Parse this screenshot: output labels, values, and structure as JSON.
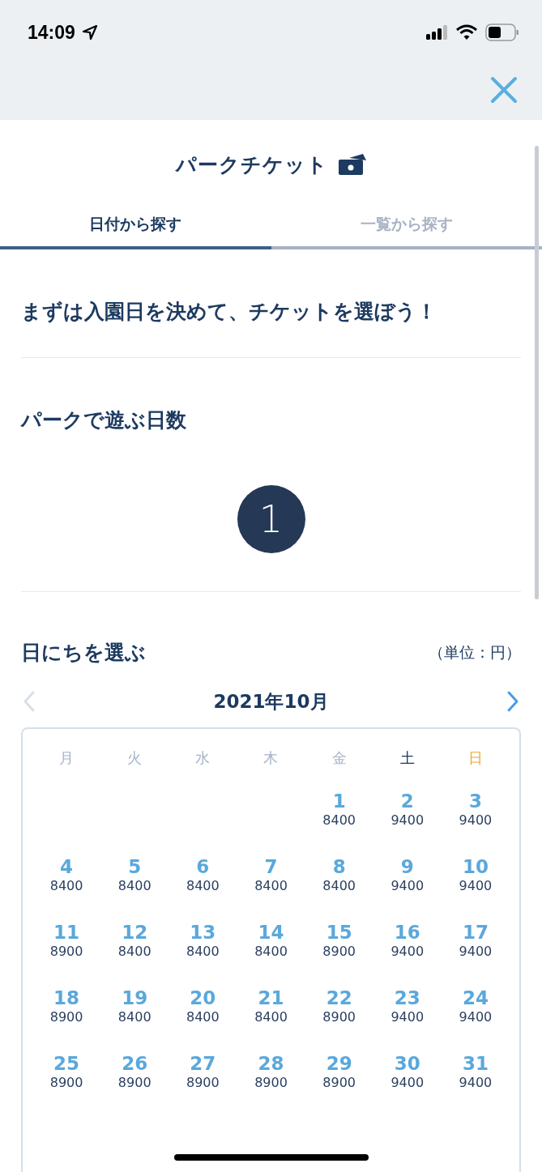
{
  "status_bar": {
    "time": "14:09"
  },
  "header": {
    "title": "パークチケット"
  },
  "tabs": [
    {
      "label": "日付から探す",
      "selected": true
    },
    {
      "label": "一覧から探す",
      "selected": false
    }
  ],
  "intro": "まずは入園日を決めて、チケットを選ぼう！",
  "days_section": {
    "heading": "パークで遊ぶ日数",
    "count": "1"
  },
  "calendar_section": {
    "heading": "日にちを選ぶ",
    "unit_note": "（単位：円）",
    "month": "2021年10月",
    "prev_month": {
      "disabled": true
    },
    "next_month": {
      "disabled": false
    },
    "weekdays": [
      {
        "label": "月",
        "kind": "weekday"
      },
      {
        "label": "火",
        "kind": "weekday"
      },
      {
        "label": "水",
        "kind": "weekday"
      },
      {
        "label": "木",
        "kind": "weekday"
      },
      {
        "label": "金",
        "kind": "weekday"
      },
      {
        "label": "土",
        "kind": "saturday"
      },
      {
        "label": "日",
        "kind": "sunday"
      }
    ],
    "weeks": [
      [
        {
          "kind": "empty"
        },
        {
          "kind": "empty"
        },
        {
          "kind": "empty"
        },
        {
          "kind": "empty"
        },
        {
          "kind": "day",
          "day": "1",
          "price": "8400"
        },
        {
          "kind": "day",
          "day": "2",
          "price": "9400"
        },
        {
          "kind": "day",
          "day": "3",
          "price": "9400"
        }
      ],
      [
        {
          "kind": "day",
          "day": "4",
          "price": "8400"
        },
        {
          "kind": "day",
          "day": "5",
          "price": "8400"
        },
        {
          "kind": "day",
          "day": "6",
          "price": "8400"
        },
        {
          "kind": "day",
          "day": "7",
          "price": "8400"
        },
        {
          "kind": "day",
          "day": "8",
          "price": "8400"
        },
        {
          "kind": "day",
          "day": "9",
          "price": "9400"
        },
        {
          "kind": "day",
          "day": "10",
          "price": "9400"
        }
      ],
      [
        {
          "kind": "day",
          "day": "11",
          "price": "8900"
        },
        {
          "kind": "day",
          "day": "12",
          "price": "8400"
        },
        {
          "kind": "day",
          "day": "13",
          "price": "8400"
        },
        {
          "kind": "day",
          "day": "14",
          "price": "8400"
        },
        {
          "kind": "day",
          "day": "15",
          "price": "8900"
        },
        {
          "kind": "day",
          "day": "16",
          "price": "9400"
        },
        {
          "kind": "day",
          "day": "17",
          "price": "9400"
        }
      ],
      [
        {
          "kind": "day",
          "day": "18",
          "price": "8900"
        },
        {
          "kind": "day",
          "day": "19",
          "price": "8400"
        },
        {
          "kind": "day",
          "day": "20",
          "price": "8400"
        },
        {
          "kind": "day",
          "day": "21",
          "price": "8400"
        },
        {
          "kind": "day",
          "day": "22",
          "price": "8900"
        },
        {
          "kind": "day",
          "day": "23",
          "price": "9400"
        },
        {
          "kind": "day",
          "day": "24",
          "price": "9400"
        }
      ],
      [
        {
          "kind": "day",
          "day": "25",
          "price": "8900"
        },
        {
          "kind": "day",
          "day": "26",
          "price": "8900"
        },
        {
          "kind": "day",
          "day": "27",
          "price": "8900"
        },
        {
          "kind": "day",
          "day": "28",
          "price": "8900"
        },
        {
          "kind": "day",
          "day": "29",
          "price": "8900"
        },
        {
          "kind": "day",
          "day": "30",
          "price": "9400"
        },
        {
          "kind": "day",
          "day": "31",
          "price": "9400"
        }
      ]
    ]
  }
}
